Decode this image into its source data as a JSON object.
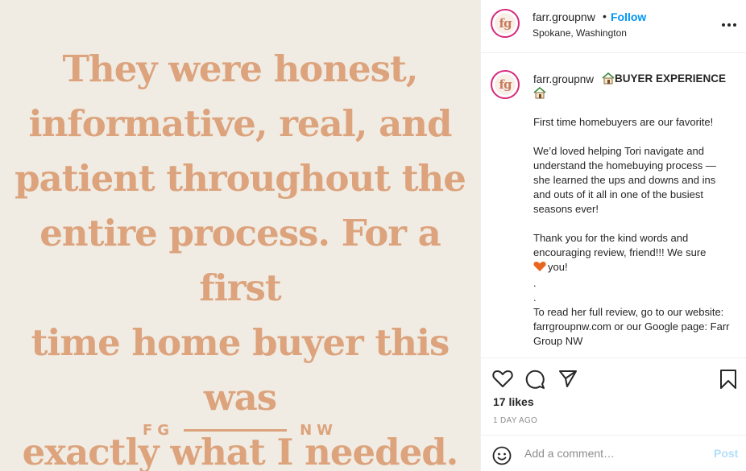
{
  "media": {
    "quote_lines": [
      "They were honest,",
      "informative, real, and",
      "patient throughout the",
      "entire process. For a first",
      "time home buyer this was",
      "exactly what I needed."
    ],
    "brand_left": "FG",
    "brand_right": "NW",
    "background_color": "#f0ebe3",
    "text_color": "#dca37c"
  },
  "header": {
    "avatar_text": "fg",
    "username": "farr.groupnw",
    "separator": "•",
    "follow_label": "Follow",
    "location": "Spokane, Washington",
    "more_icon": "more-options-icon"
  },
  "caption": {
    "avatar_text": "fg",
    "username": "farr.groupnw",
    "title": "BUYER EXPERIENCE",
    "para1": "First time homebuyers are our favorite!",
    "para2": "We’d loved helping Tori navigate and understand the homebuying process — she learned the ups and downs and ins and outs of it all in one of the busiest seasons ever!",
    "para3a": "Thank you for the kind words and encouraging review, friend!!! We sure",
    "para3b": "you!",
    "dot1": ".",
    "dot2": ".",
    "para4": "To read her full review, go to our website: farrgroupnw.com or our Google page: Farr Group NW"
  },
  "actions": {
    "likes": "17 likes",
    "time": "1 DAY AGO"
  },
  "comment": {
    "placeholder": "Add a comment…",
    "post_label": "Post"
  },
  "colors": {
    "accent": "#0095f6",
    "post_disabled": "#b2dffc",
    "heart": "#e8661f"
  }
}
